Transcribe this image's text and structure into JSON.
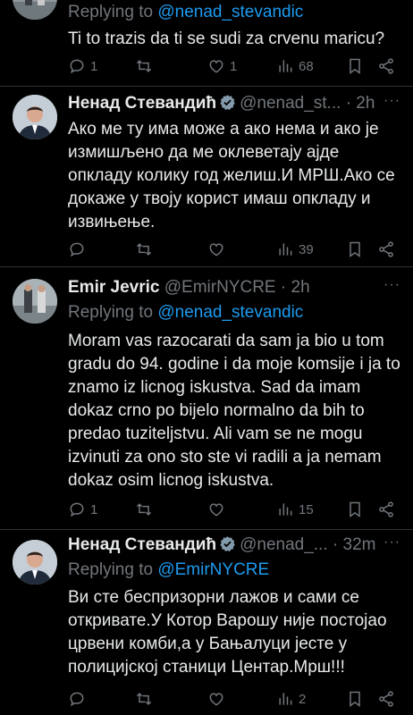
{
  "tweets": [
    {
      "reply_label": "Replying to",
      "reply_to": "@nenad_stevandic",
      "text": "Ti to trazis da ti se sudi za crvenu maricu?",
      "stats": {
        "replies": "1",
        "retweets": "",
        "likes": "1",
        "views": "68"
      }
    },
    {
      "name": "Ненад Стевандић",
      "handle": "@nenad_st...",
      "time": "· 2h",
      "text": "Ако ме ту има може а ако нема и ако је измишљено да ме оклеветају ајде опкладу колику год желиш.И МРШ.Ако се докаже у твоју корист имаш опкладу и извињење.",
      "stats": {
        "replies": "",
        "retweets": "",
        "likes": "",
        "views": "39"
      }
    },
    {
      "name": "Emir Jevric",
      "handle": "@EmirNYCRE",
      "time": "· 2h",
      "reply_label": "Replying to",
      "reply_to": "@nenad_stevandic",
      "text": "Moram vas razocarati da sam ja bio u tom gradu do 94. godine i da moje komsije i ja to znamo iz licnog iskustva. Sad da imam dokaz crno po bijelo normalno da bih to predao tuziteljstvu. Ali vam se ne mogu izvinuti za ono sto ste vi radili a ja nemam dokaz osim licnog iskustva.",
      "stats": {
        "replies": "1",
        "retweets": "",
        "likes": "",
        "views": "15"
      }
    },
    {
      "name": "Ненад Стевандић",
      "handle": "@nenad_...",
      "time": "· 32m",
      "reply_label": "Replying to",
      "reply_to": "@EmirNYCRE",
      "text": "Ви сте беспризорни лажов и сами се откривате.У Котор Варошу није постојао црвени комби,а у Бањалуци јесте у полицијској станици Центар.Мрш!!!",
      "stats": {
        "replies": "",
        "retweets": "",
        "likes": "",
        "views": "2"
      }
    }
  ],
  "colors": {
    "background": "#000000",
    "text": "#e7e9ea",
    "muted": "#71767b",
    "link": "#1d9bf0",
    "verified": "#829aab"
  },
  "icons": [
    "reply-icon",
    "retweet-icon",
    "like-icon",
    "views-icon",
    "bookmark-icon",
    "share-icon",
    "verified-badge-icon",
    "more-icon"
  ]
}
